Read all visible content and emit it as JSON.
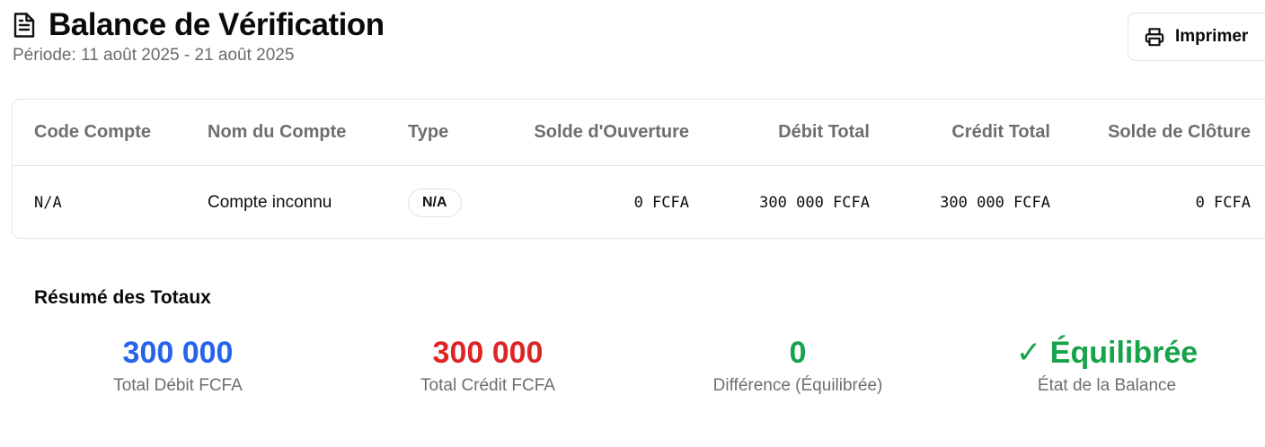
{
  "header": {
    "title": "Balance de Vérification",
    "period": "Période: 11 août 2025 - 21 août 2025",
    "icon": "document-icon"
  },
  "toolbar": {
    "print_label": "Imprimer",
    "print_icon": "printer-icon"
  },
  "table": {
    "columns": [
      "Code Compte",
      "Nom du Compte",
      "Type",
      "Solde d'Ouverture",
      "Débit Total",
      "Crédit Total",
      "Solde de Clôture"
    ],
    "rows": [
      {
        "code": "N/A",
        "name": "Compte inconnu",
        "type": "N/A",
        "opening": "0 FCFA",
        "debit": "300 000 FCFA",
        "credit": "300 000 FCFA",
        "closing": "0 FCFA"
      }
    ]
  },
  "summary": {
    "title": "Résumé des Totaux",
    "items": [
      {
        "value": "300 000",
        "label": "Total Débit FCFA",
        "color": "#2563eb"
      },
      {
        "value": "300 000",
        "label": "Total Crédit FCFA",
        "color": "#dc2626"
      },
      {
        "value": "0",
        "label": "Différence (Équilibrée)",
        "color": "#16a34a"
      },
      {
        "value": "✓ Équilibrée",
        "label": "État de la Balance",
        "color": "#16a34a"
      }
    ]
  }
}
